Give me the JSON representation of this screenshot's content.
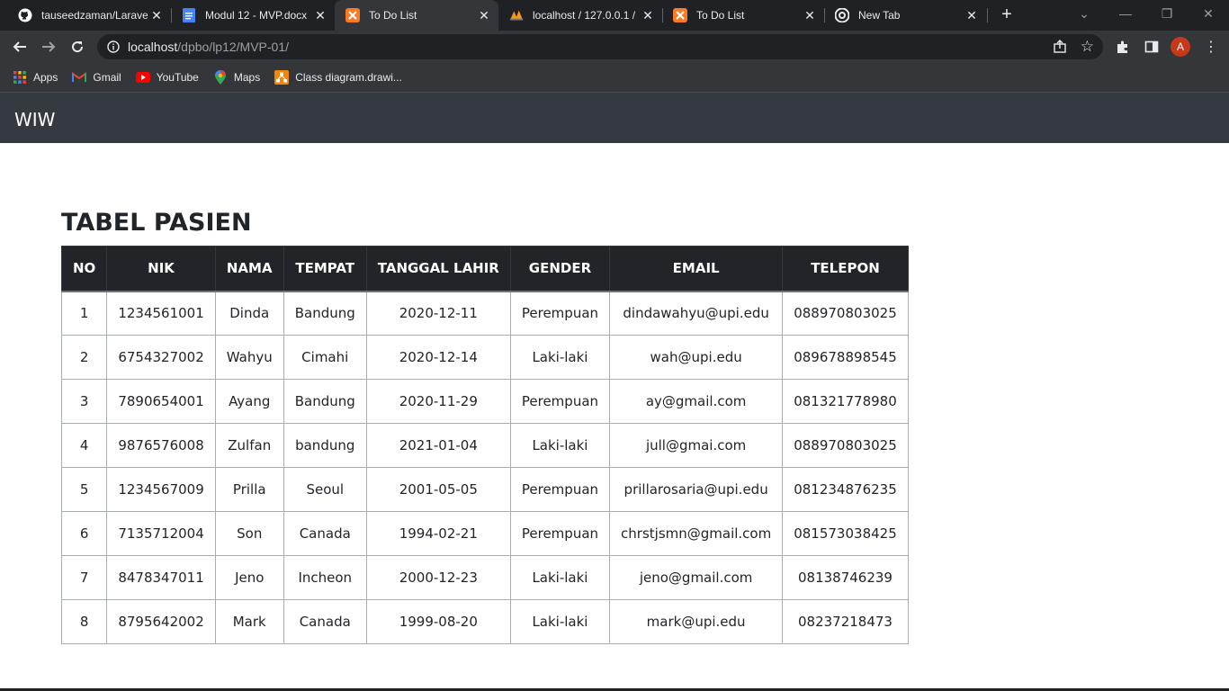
{
  "browser": {
    "tabs": [
      {
        "title": "tauseedzaman/Laravel",
        "icon": "github-icon"
      },
      {
        "title": "Modul 12 - MVP.docx",
        "icon": "docs-icon"
      },
      {
        "title": "To Do List",
        "icon": "xampp-icon",
        "active": true
      },
      {
        "title": "localhost / 127.0.0.1 /",
        "icon": "phpmyadmin-icon"
      },
      {
        "title": "To Do List",
        "icon": "xampp-icon"
      },
      {
        "title": "New Tab",
        "icon": "chrome-icon"
      }
    ],
    "address": {
      "host": "localhost",
      "path": "/dpbo/lp12/MVP-01/"
    },
    "profile_initial": "A",
    "accent_color": "#c5381b",
    "bookmarks": [
      {
        "label": "Apps",
        "icon": "apps-grid-icon"
      },
      {
        "label": "Gmail",
        "icon": "gmail-icon"
      },
      {
        "label": "YouTube",
        "icon": "youtube-icon"
      },
      {
        "label": "Maps",
        "icon": "maps-icon"
      },
      {
        "label": "Class diagram.drawi...",
        "icon": "drawio-icon"
      }
    ]
  },
  "page": {
    "brand": "WIW",
    "title": "TABEL PASIEN",
    "table": {
      "headers": [
        "NO",
        "NIK",
        "NAMA",
        "TEMPAT",
        "TANGGAL LAHIR",
        "GENDER",
        "EMAIL",
        "TELEPON"
      ],
      "rows": [
        [
          "1",
          "1234561001",
          "Dinda",
          "Bandung",
          "2020-12-11",
          "Perempuan",
          "dindawahyu@upi.edu",
          "088970803025"
        ],
        [
          "2",
          "6754327002",
          "Wahyu",
          "Cimahi",
          "2020-12-14",
          "Laki-laki",
          "wah@upi.edu",
          "089678898545"
        ],
        [
          "3",
          "7890654001",
          "Ayang",
          "Bandung",
          "2020-11-29",
          "Perempuan",
          "ay@gmail.com",
          "081321778980"
        ],
        [
          "4",
          "9876576008",
          "Zulfan",
          "bandung",
          "2021-01-04",
          "Laki-laki",
          "jull@gmai.com",
          "088970803025"
        ],
        [
          "5",
          "1234567009",
          "Prilla",
          "Seoul",
          "2001-05-05",
          "Perempuan",
          "prillarosaria@upi.edu",
          "081234876235"
        ],
        [
          "6",
          "7135712004",
          "Son",
          "Canada",
          "1994-02-21",
          "Perempuan",
          "chrstjsmn@gmail.com",
          "081573038425"
        ],
        [
          "7",
          "8478347011",
          "Jeno",
          "Incheon",
          "2000-12-23",
          "Laki-laki",
          "jeno@gmail.com",
          "08138746239"
        ],
        [
          "8",
          "8795642002",
          "Mark",
          "Canada",
          "1999-08-20",
          "Laki-laki",
          "mark@upi.edu",
          "08237218473"
        ]
      ]
    }
  }
}
